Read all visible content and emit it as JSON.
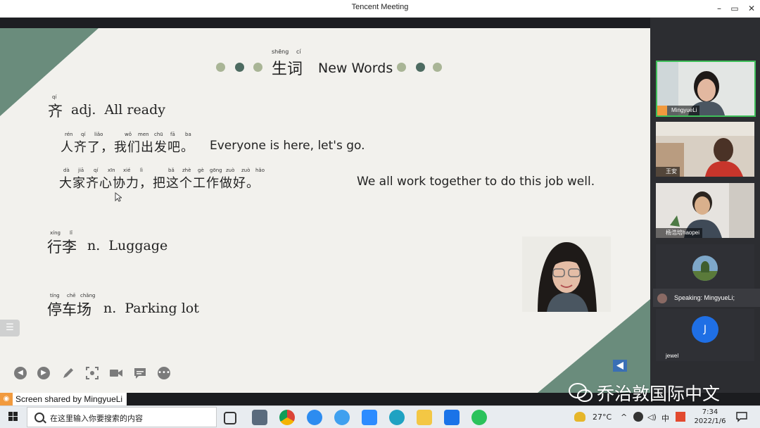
{
  "window": {
    "title": "Tencent Meeting",
    "controls": {
      "minimize": "–",
      "restore": "▭",
      "close": "✕"
    }
  },
  "slide": {
    "title_pinyin_1": "shēng",
    "title_pinyin_2": "cí",
    "title_chars": "生词",
    "title_en": "New Words",
    "word1": {
      "pinyin": "qí",
      "hanzi": "齐",
      "rest": "adj.  All ready"
    },
    "ex1": {
      "pinyin": [
        "rén",
        "qí",
        "liǎo",
        "wǒ",
        "men",
        "chū",
        "fā",
        "ba"
      ],
      "hanzi": "人齐了，我们出发吧。",
      "en": "Everyone is here, let's go."
    },
    "ex2": {
      "pinyin": [
        "dà",
        "jiā",
        "qí",
        "xīn",
        "xié",
        "lì",
        "bǎ",
        "zhè",
        "gè",
        "gōng",
        "zuò",
        "zuò",
        "hǎo"
      ],
      "hanzi": "大家齐心协力，把这个工作做好。",
      "en": "We all work together to do this job well."
    },
    "word2": {
      "pinyin": [
        "xíng",
        "lǐ"
      ],
      "hanzi": "行李",
      "rest": "n.  Luggage"
    },
    "word3": {
      "pinyin": [
        "tíng",
        "chē",
        "chǎng"
      ],
      "hanzi": "停车场",
      "rest": "n.  Parking lot"
    }
  },
  "participants": [
    {
      "name": "MingyueLi"
    },
    {
      "name": "王安"
    },
    {
      "name": "杨浩培haopei"
    },
    {
      "name": ""
    },
    {
      "name": "jewel",
      "avatar_letter": "J"
    }
  ],
  "speaking": "Speaking: MingyueLi;",
  "share_label": "Screen shared by MingyueLi",
  "watermark": "乔治敦国际中文",
  "taskbar": {
    "search_placeholder": "在这里输入你要搜索的内容",
    "weather": "27°C",
    "ime": "中",
    "time": "7:34",
    "date": "2022/1/6"
  },
  "colors": {
    "slide_bg": "#f2f1ed",
    "accent_green": "#6a8c7c",
    "dot_light": "#a9b596",
    "dot_dark": "#4d6b61",
    "speaker_border": "#3fbf5a",
    "arrow_blue": "#3a6fb5"
  }
}
